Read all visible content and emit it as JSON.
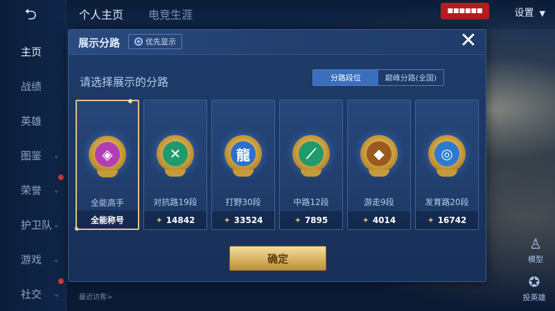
{
  "background": {
    "topbar": {
      "tabs": [
        "个人主页",
        "电竞生涯"
      ],
      "settings_label": "设置",
      "user_badge": "■■■■■■"
    },
    "sidebar": {
      "items": [
        {
          "label": "主页",
          "has_chevron": false
        },
        {
          "label": "战绩",
          "has_chevron": false
        },
        {
          "label": "英雄",
          "has_chevron": false
        },
        {
          "label": "图鉴",
          "has_chevron": true
        },
        {
          "label": "荣誉",
          "has_chevron": true
        },
        {
          "label": "护卫队",
          "has_chevron": true
        },
        {
          "label": "游戏",
          "has_chevron": true
        },
        {
          "label": "社交",
          "has_chevron": true
        }
      ]
    },
    "right_buttons": {
      "model_label": "模型",
      "vote_label": "投英雄"
    },
    "recent_label": "最近访客>"
  },
  "modal": {
    "title": "展示分路",
    "priority_button": "优先显示",
    "close_glyph": "✕",
    "prompt": "请选择展示的分路",
    "segments": [
      {
        "label": "分路段位",
        "active": true
      },
      {
        "label": "巅峰分路(全国)",
        "active": false
      }
    ],
    "cards": [
      {
        "label": "全能高手",
        "stat": "全能称号",
        "selected": true,
        "emblem_color": "#b33db5",
        "emblem_icon": "hexagon-icon",
        "glyph": "◈",
        "show_power_icon": false
      },
      {
        "label": "对抗路19段",
        "stat": "14842",
        "selected": false,
        "emblem_color": "#1f9a6e",
        "emblem_icon": "crossed-swords-icon",
        "glyph": "✕",
        "show_power_icon": true
      },
      {
        "label": "打野30段",
        "stat": "33524",
        "selected": false,
        "emblem_color": "#2b6fd1",
        "emblem_icon": "dragon-icon",
        "glyph": "龍",
        "show_power_icon": true
      },
      {
        "label": "中路12段",
        "stat": "7895",
        "selected": false,
        "emblem_color": "#1f9a6e",
        "emblem_icon": "slash-icon",
        "glyph": "⟋",
        "show_power_icon": true
      },
      {
        "label": "游走9段",
        "stat": "4014",
        "selected": false,
        "emblem_color": "#9a5a1f",
        "emblem_icon": "shield-wing-icon",
        "glyph": "◆",
        "show_power_icon": true
      },
      {
        "label": "发育路20段",
        "stat": "16742",
        "selected": false,
        "emblem_color": "#2b7ad1",
        "emblem_icon": "target-icon",
        "glyph": "◎",
        "show_power_icon": true
      }
    ],
    "confirm_button": "确定"
  },
  "colors": {
    "accent_gold": "#e3c48a",
    "segment_active": "#3a6fbf",
    "modal_bg": "#1f3c6b"
  }
}
